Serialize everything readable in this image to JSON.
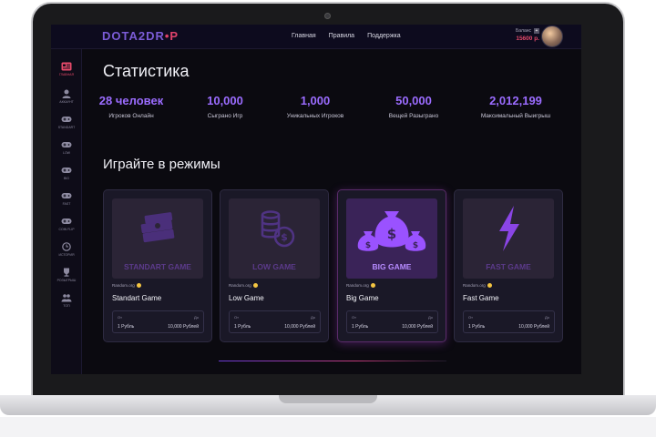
{
  "header": {
    "logo_left": "DOTA2DR",
    "logo_accent": "•P",
    "nav": [
      "Главная",
      "Правила",
      "Поддержка"
    ],
    "balance_label": "Баланс",
    "balance_plus": "+",
    "balance_value": "15600 р."
  },
  "sidebar": {
    "items": [
      {
        "label": "Главная",
        "icon": "home-icon"
      },
      {
        "label": "Аккаунт",
        "icon": "user-icon"
      },
      {
        "label": "Standart",
        "icon": "gamepad-icon"
      },
      {
        "label": "Low",
        "icon": "gamepad-icon"
      },
      {
        "label": "Big",
        "icon": "gamepad-icon"
      },
      {
        "label": "Fast",
        "icon": "gamepad-icon"
      },
      {
        "label": "Coin Flip",
        "icon": "gamepad-icon"
      },
      {
        "label": "История",
        "icon": "clock-icon"
      },
      {
        "label": "Розыгрыш",
        "icon": "trophy-icon"
      },
      {
        "label": "Топ",
        "icon": "group-icon"
      }
    ]
  },
  "stats": {
    "title": "Статистика",
    "items": [
      {
        "value": "28 человек",
        "label": "Игроков Онлайн"
      },
      {
        "value": "10,000",
        "label": "Сыграно Игр"
      },
      {
        "value": "1,000",
        "label": "Уникальных Игроков"
      },
      {
        "value": "50,000",
        "label": "Вещей Разыграно"
      },
      {
        "value": "2,012,199",
        "label": "Максимальный Выигрыш"
      }
    ]
  },
  "modes": {
    "title": "Играйте в режимы",
    "cards": [
      {
        "img_title": "STANDART GAME",
        "provider": "Random.org",
        "name": "Standart Game",
        "from_label": "От",
        "to_label": "До",
        "from": "1 Рубль",
        "to": "10,000 Рублей"
      },
      {
        "img_title": "LOW GAME",
        "provider": "Random.org",
        "name": "Low Game",
        "from_label": "От",
        "to_label": "До",
        "from": "1 Рубль",
        "to": "10,000 Рублей"
      },
      {
        "img_title": "BIG GAME",
        "provider": "Random.org",
        "name": "Big Game",
        "from_label": "От",
        "to_label": "До",
        "from": "1 Рубль",
        "to": "10,000 Рублей"
      },
      {
        "img_title": "FAST GAME",
        "provider": "Random.org",
        "name": "Fast Game",
        "from_label": "От",
        "to_label": "До",
        "from": "1 Рубль",
        "to": "10,000 Рублей"
      }
    ]
  },
  "colors": {
    "accent_purple": "#9b6cff",
    "accent_red": "#e34a6a",
    "background": "#0b0a10",
    "card": "#1a1827"
  }
}
